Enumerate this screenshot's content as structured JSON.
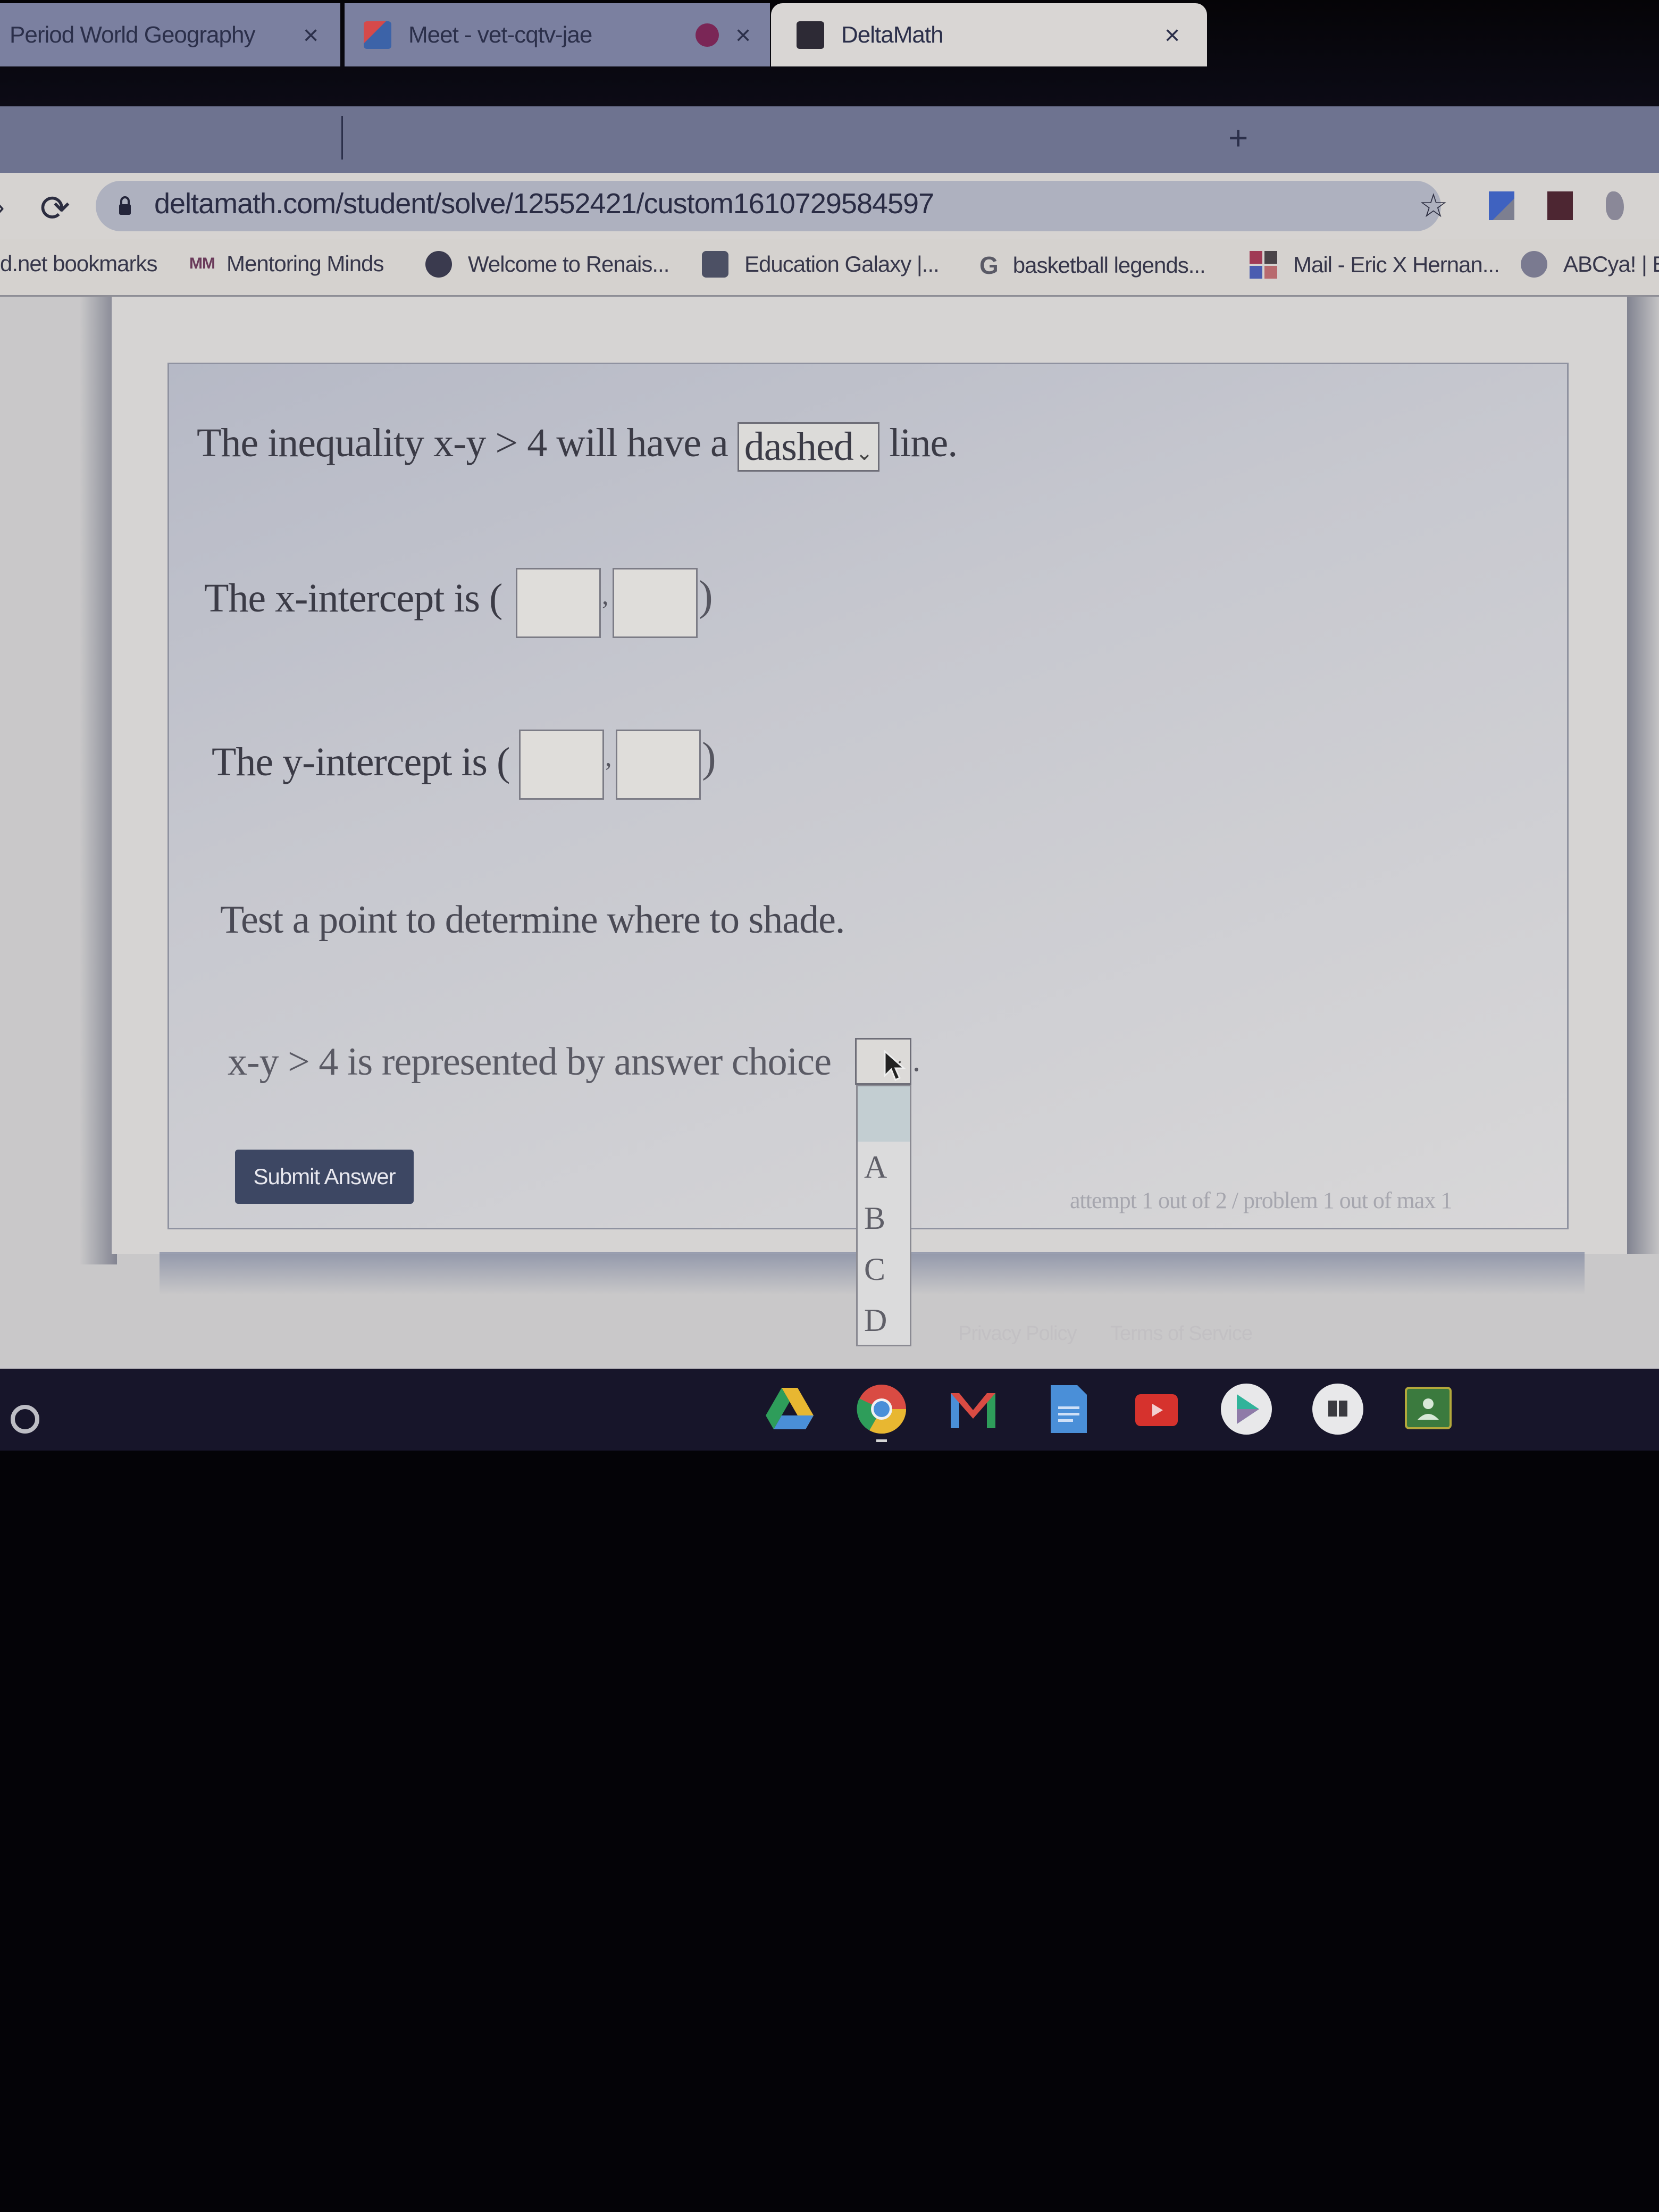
{
  "browser": {
    "tabs": [
      {
        "title": "Period World Geography",
        "favicon": "classroom-icon",
        "active": false
      },
      {
        "title": "Meet - vet-cqtv-jae",
        "favicon": "meet-icon",
        "active": false,
        "recording_indicator": true
      },
      {
        "title": "DeltaMath",
        "favicon": "deltamath-icon",
        "active": true
      }
    ],
    "new_tab_label": "+",
    "close_glyph": "×",
    "url": "deltamath.com/student/solve/12552421/custom1610729584597",
    "bookmarks": [
      {
        "label": "d.net bookmarks",
        "icon": ""
      },
      {
        "label": "Mentoring Minds",
        "icon": "MM"
      },
      {
        "label": "Welcome to Renais...",
        "icon": "renaissance-icon"
      },
      {
        "label": "Education Galaxy |...",
        "icon": "education-galaxy-icon"
      },
      {
        "label": "basketball legends...",
        "icon": "G"
      },
      {
        "label": "Mail - Eric X Hernan...",
        "icon": "office-icon"
      },
      {
        "label": "ABCya! | E",
        "icon": "abcya-icon"
      }
    ]
  },
  "problem": {
    "line1": {
      "prefix": "The inequality x-y > 4 will have a",
      "select_value": "dashed",
      "suffix": "line."
    },
    "x_intercept": {
      "label": "The x-intercept is (",
      "comma": ",",
      "close": ")",
      "x_value": "",
      "y_value": ""
    },
    "y_intercept": {
      "label": "The y-intercept is (",
      "comma": ",",
      "close": ")",
      "x_value": "",
      "y_value": ""
    },
    "test_point": "Test a point to determine where to shade.",
    "answer_choice": {
      "label": "x-y > 4 is represented by answer choice",
      "period": ".",
      "selected": "",
      "options": [
        "",
        "A",
        "B",
        "C",
        "D"
      ]
    },
    "submit_label": "Submit Answer",
    "attempt_text": "attempt 1 out of 2 / problem 1 out of max 1"
  },
  "footer": {
    "privacy": "Privacy Policy",
    "terms": "Terms of Service"
  },
  "shelf": {
    "apps": [
      "google-drive",
      "chrome",
      "gmail",
      "google-docs",
      "youtube",
      "play-store",
      "books",
      "google-classroom"
    ],
    "active_app": "chrome"
  },
  "colors": {
    "submit_bg": "#3d4763",
    "problem_border": "#8f92a0",
    "shelf_bg": "#17152a"
  }
}
